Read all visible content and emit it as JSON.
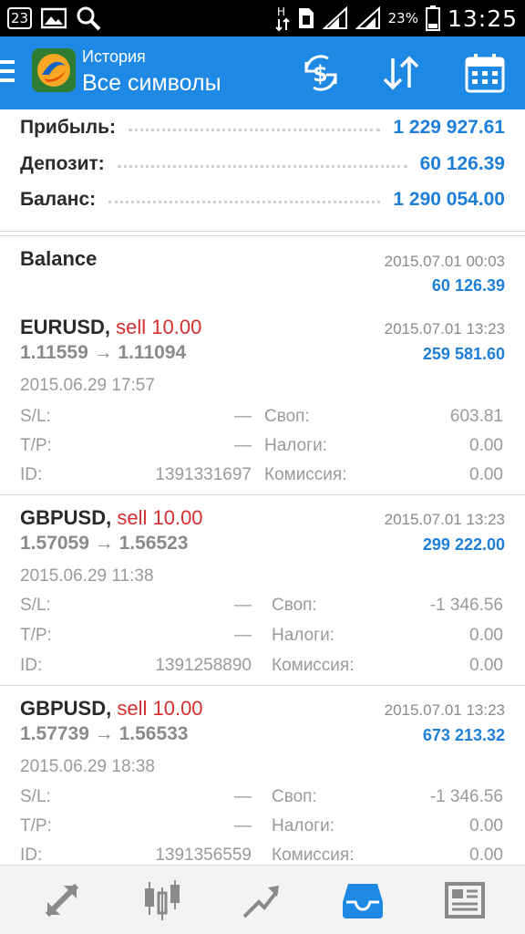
{
  "status_bar": {
    "notification_badge": "23",
    "battery_percent": "23%",
    "time": "13:25",
    "icons": [
      "image-icon",
      "search-icon",
      "network-arrows-icon",
      "sim-icon",
      "signal-icon",
      "wifi-icon",
      "battery-icon"
    ]
  },
  "appbar": {
    "subtitle": "История",
    "title": "Все символы",
    "accent": "#1e88e5",
    "actions": [
      "currency-exchange-icon",
      "sort-icon",
      "calendar-icon"
    ]
  },
  "summary": {
    "profit_label": "Прибыль:",
    "profit_value": "1 229 927.61",
    "deposit_label": "Депозит:",
    "deposit_value": "60 126.39",
    "balance_label": "Баланс:",
    "balance_value": "1 290 054.00"
  },
  "balance_record": {
    "title": "Balance",
    "date": "2015.07.01 00:03",
    "amount": "60 126.39"
  },
  "labels": {
    "sl": "S/L:",
    "tp": "T/P:",
    "id": "ID:",
    "swap": "Своп:",
    "taxes": "Налоги:",
    "commission": "Комиссия:"
  },
  "trades": [
    {
      "symbol": "EURUSD",
      "side": "sell 10.00",
      "prices": "1.11559 → 1.11094",
      "open_date": "2015.06.29 17:57",
      "close_date": "2015.07.01 13:23",
      "profit": "259 581.60",
      "sl": "—",
      "tp": "—",
      "id": "1391331697",
      "swap": "603.81",
      "taxes": "0.00",
      "commission": "0.00"
    },
    {
      "symbol": "GBPUSD",
      "side": "sell 10.00",
      "prices": "1.57059 → 1.56523",
      "open_date": "2015.06.29 11:38",
      "close_date": "2015.07.01 13:23",
      "profit": "299 222.00",
      "sl": "—",
      "tp": "—",
      "id": "1391258890",
      "swap": "-1 346.56",
      "taxes": "0.00",
      "commission": "0.00"
    },
    {
      "symbol": "GBPUSD",
      "side": "sell 10.00",
      "prices": "1.57739 → 1.56533",
      "open_date": "2015.06.29 18:38",
      "close_date": "2015.07.01 13:23",
      "profit": "673 213.32",
      "sl": "—",
      "tp": "—",
      "id": "1391356559",
      "swap": "-1 346.56",
      "taxes": "0.00",
      "commission": "0.00"
    }
  ],
  "bottom_nav": {
    "items": [
      "quotes-icon",
      "chart-icon",
      "trade-icon",
      "history-icon",
      "news-icon"
    ],
    "active": "history-icon",
    "active_color": "#1e88e5"
  },
  "colors": {
    "sell": "#d32f2f",
    "profit": "#1e7fd9"
  }
}
